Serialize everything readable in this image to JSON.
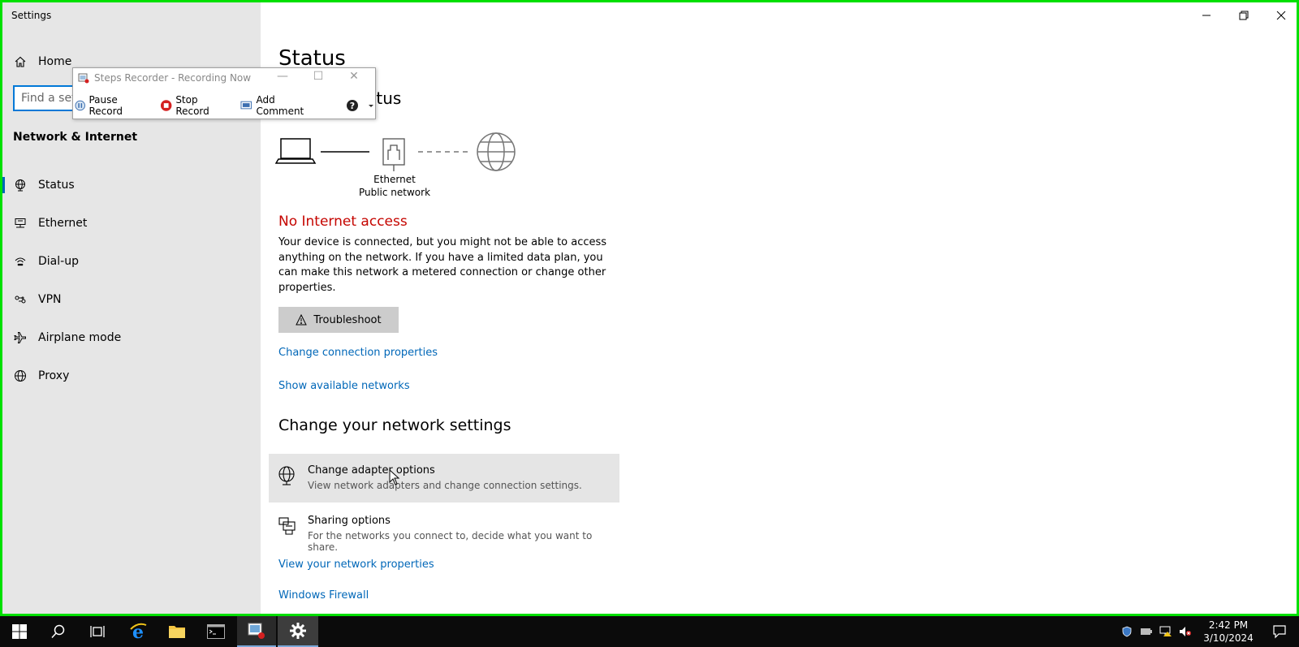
{
  "window": {
    "app_title": "Settings",
    "controls": {
      "minimize": "—",
      "maximize": "❐",
      "close": "✕"
    }
  },
  "sidebar": {
    "home_label": "Home",
    "search_placeholder": "Find a setting",
    "section_title": "Network & Internet",
    "items": [
      {
        "label": "Status",
        "icon": "status-globe-icon",
        "selected": true
      },
      {
        "label": "Ethernet",
        "icon": "ethernet-icon"
      },
      {
        "label": "Dial-up",
        "icon": "dialup-icon"
      },
      {
        "label": "VPN",
        "icon": "vpn-icon"
      },
      {
        "label": "Airplane mode",
        "icon": "airplane-icon"
      },
      {
        "label": "Proxy",
        "icon": "proxy-globe-icon"
      }
    ]
  },
  "main": {
    "title": "Status",
    "subtitle": "Network status",
    "diagram": {
      "adapter_name": "Ethernet",
      "network_type": "Public network"
    },
    "status_heading": "No Internet access",
    "status_description": "Your device is connected, but you might not be able to access anything on the network. If you have a limited data plan, you can make this network a metered connection or change other properties.",
    "troubleshoot_label": "Troubleshoot",
    "link_change_connection": "Change connection properties",
    "link_show_networks": "Show available networks",
    "settings_heading": "Change your network settings",
    "options": [
      {
        "title": "Change adapter options",
        "description": "View network adapters and change connection settings.",
        "icon": "adapter-globe-icon"
      },
      {
        "title": "Sharing options",
        "description": "For the networks you connect to, decide what you want to share.",
        "icon": "sharing-icon"
      }
    ],
    "link_view_properties": "View your network properties",
    "link_firewall": "Windows Firewall"
  },
  "steps_recorder": {
    "title": "Steps Recorder - Recording Now",
    "pause_label": "Pause Record",
    "stop_label": "Stop Record",
    "comment_label": "Add Comment"
  },
  "taskbar": {
    "time": "2:42 PM",
    "date": "3/10/2024"
  },
  "colors": {
    "accent": "#0067b8",
    "error": "#c50500",
    "sidebar_bg": "#e6e6e6",
    "frame": "#00e000",
    "taskbar": "#0b0b0b"
  }
}
